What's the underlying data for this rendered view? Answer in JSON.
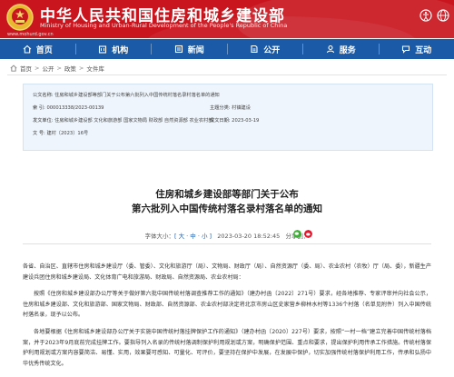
{
  "header": {
    "title": "中华人民共和国住房和城乡建设部",
    "subtitle": "Ministry of Housing and Urban-Rural Development of the People's Republic of China",
    "url": "www.mohurd.gov.cn",
    "brand_color": "#c9151e"
  },
  "nav": {
    "color": "#1a5aa6",
    "items": [
      {
        "label": "首页",
        "icon": "home-icon"
      },
      {
        "label": "机构",
        "icon": "org-icon"
      },
      {
        "label": "新闻",
        "icon": "news-icon"
      },
      {
        "label": "公开",
        "icon": "disclosure-icon"
      },
      {
        "label": "服务",
        "icon": "service-icon"
      },
      {
        "label": "互动",
        "icon": "interaction-icon"
      }
    ]
  },
  "breadcrumb": [
    "首页",
    "公开",
    "政策",
    "文件库"
  ],
  "meta": {
    "index_label": "公文名称:",
    "index_value": "住房和城乡建设部等部门关于公布第六批列入中国传统村落名录村落名单的通知",
    "number_label": "索  引:",
    "number_value": "000013338/2023-00139",
    "category_label": "主题分类:",
    "category_value": "村镇建设",
    "issuer_label": "发文单位:",
    "issuer_value": "住房和城乡建设部  文化和旅游部  国家文物局  财政部  自然资源部  农业农村部",
    "date_label": "成文日期:",
    "date_value": "2023-03-19",
    "doc_no_label": "文  号:",
    "doc_no_value": "建村〔2023〕16号"
  },
  "article": {
    "title_line1": "住房和城乡建设部等部门关于公布",
    "title_line2": "第六批列入中国传统村落名录村落名单的通知",
    "font_label": "字体大小：",
    "font_options": "[ 大 · 中 · 小 ]",
    "date": "2023-03-20 18:52:45",
    "share_label": "分享到：",
    "p1": "各省、自治区、直辖市住房和城乡建设厅（委、管委）、文化和旅游厅（局）、文物局、财政厅（局）、自然资源厅（委、局）、农业农村（农牧）厅（局、委），新疆生产建设兵团住房和城乡建设局、文化体育广电和旅游局、财政局、自然资源局、农业农村局：",
    "p2": "按照《住房和城乡建设部办公厅等关于做好第六批中国传统村落调查推荐工作的通知》（建办村函〔2022〕271号）要求，经各地推荐、专家评审并向社会公示，住房和城乡建设部、文化和旅游部、国家文物局、财政部、自然资源部、农业农村部决定将北京市房山区史家营乡柳林水村等1336个村落（名单见附件）列入中国传统村落名录，现予以公布。",
    "p3": "各地要根据《住房和城乡建设部办公厅关于实施中国传统村落挂牌保护工作的通知》（建办村函〔2020〕227号）要求，按照“一村一档”建立完善中国传统村落档案，并于2023年9月底前完成挂牌工作。要指导列入名录的传统村落调制保护利用规划或方案，明确保护范围、重点和要求，提出保护利用传承工作措施。传统村落保护利用规划或方案内容要简洁、易懂、实用，效果要可感知、可量化、可评价，要坚持在保护中发展，在发展中保护，切实加强传统村落保护利用工作，传承和弘扬中华优秀传统文化。"
  }
}
